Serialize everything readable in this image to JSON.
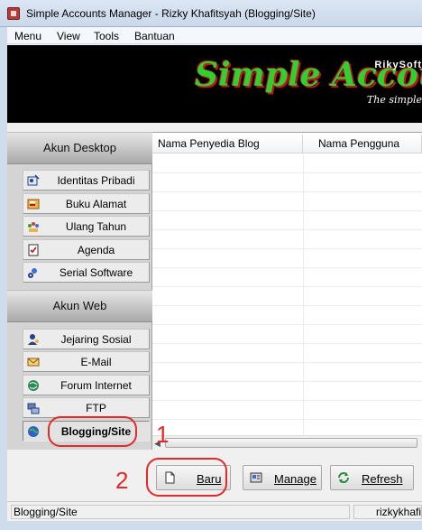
{
  "window": {
    "title": "Simple Accounts Manager - Rizky Khafitsyah (Blogging/Site)"
  },
  "menu": [
    {
      "label": "Menu"
    },
    {
      "label": "View"
    },
    {
      "label": "Tools"
    },
    {
      "label": "Bantuan"
    }
  ],
  "banner": {
    "brand": "RikySoft",
    "title": "Simple Accounts",
    "tagline": "The simple"
  },
  "sidebar": {
    "desktop_header": "Akun Desktop",
    "desktop_items": [
      {
        "label": "Identitas Pribadi",
        "icon": "id-card-icon"
      },
      {
        "label": "Buku Alamat",
        "icon": "address-book-icon"
      },
      {
        "label": "Ulang Tahun",
        "icon": "birthday-icon"
      },
      {
        "label": "Agenda",
        "icon": "agenda-icon"
      },
      {
        "label": "Serial Software",
        "icon": "serial-key-icon"
      }
    ],
    "web_header": "Akun Web",
    "web_items": [
      {
        "label": "Jejaring Sosial",
        "icon": "social-network-icon"
      },
      {
        "label": "E-Mail",
        "icon": "mail-icon"
      },
      {
        "label": "Forum Internet",
        "icon": "forum-icon"
      },
      {
        "label": "FTP",
        "icon": "ftp-icon"
      },
      {
        "label": "Blogging/Site",
        "icon": "globe-icon",
        "active": true
      }
    ]
  },
  "table": {
    "columns": [
      "Nama Penyedia Blog",
      "Nama Pengguna"
    ],
    "rows": []
  },
  "toolbar": {
    "new_label": "Baru",
    "manage_label": "Manage",
    "refresh_label": "Refresh"
  },
  "annotations": {
    "one": "1",
    "two": "2"
  },
  "status": {
    "section": "Blogging/Site",
    "user": "rizkykhafitsyah"
  },
  "colors": {
    "annotation": "#e32a2a",
    "banner_bg": "#000000",
    "banner_title": "#2fd02f"
  }
}
